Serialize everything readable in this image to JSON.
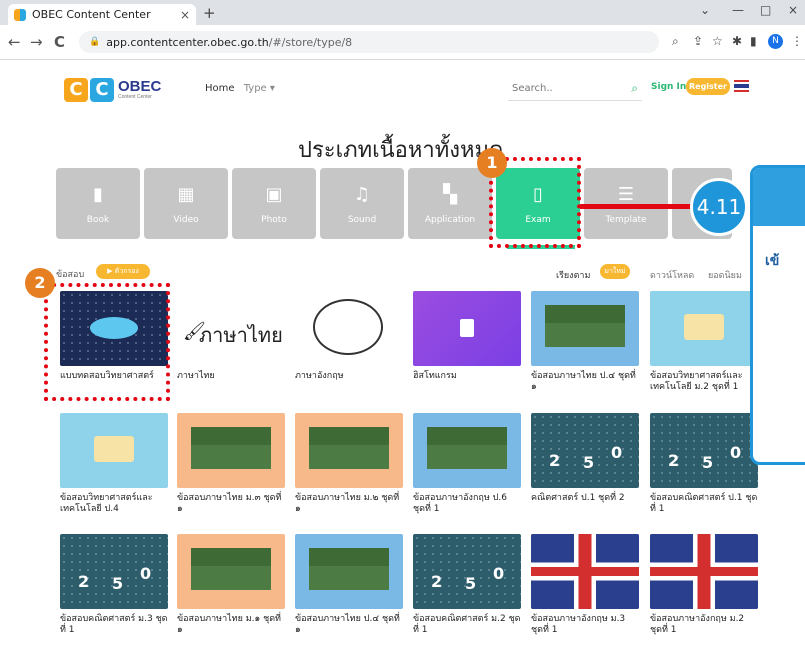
{
  "browser": {
    "tab_title": "OBEC Content Center",
    "tab_close": "×",
    "new_tab": "+",
    "url_host": "app.contentcenter.obec.go.th",
    "url_path": "/#/store/type/8",
    "back": "←",
    "forward": "→",
    "reload": "C",
    "profile_initial": "N",
    "minimize": "—",
    "maximize": "□",
    "close": "×",
    "collapse": "⌄"
  },
  "site": {
    "logo_text": "OBEC",
    "logo_sub": "Content Center",
    "nav_home": "Home",
    "nav_type": "Type ▾",
    "search_placeholder": "Search..",
    "sign_in": "Sign In",
    "register": "Register"
  },
  "heading": "ประเภทเนื้อหาทั้งหมด",
  "types": [
    {
      "label": "Book",
      "icon": "book-icon",
      "glyph": "▮"
    },
    {
      "label": "Video",
      "icon": "film-icon",
      "glyph": "▦"
    },
    {
      "label": "Photo",
      "icon": "image-icon",
      "glyph": "▣"
    },
    {
      "label": "Sound",
      "icon": "music-icon",
      "glyph": "♫"
    },
    {
      "label": "Application",
      "icon": "grid-icon",
      "glyph": "▚"
    },
    {
      "label": "Exam",
      "icon": "document-icon",
      "glyph": "▯",
      "active": true
    },
    {
      "label": "Template",
      "icon": "list-icon",
      "glyph": "☰"
    }
  ],
  "category": {
    "label": "ข้อสอบ",
    "pill": "▶ ตัวกรอง"
  },
  "sort": {
    "label": "เรียงตาม",
    "options": [
      "มาใหม่",
      "ดาวน์โหลด",
      "ยอดนิยม"
    ]
  },
  "cards": [
    {
      "title": "แบบทดสอบวิทยาศาสตร์",
      "theme": "science"
    },
    {
      "title": "ภาษาไทย",
      "theme": "thai-text"
    },
    {
      "title": "ภาษาอังกฤษ",
      "theme": "english"
    },
    {
      "title": "ฮิสโทแกรม",
      "theme": "purple"
    },
    {
      "title": "ข้อสอบภาษาไทย ป.๔ ชุดที่ ๑",
      "theme": "blue"
    },
    {
      "title": "ข้อสอบวิทยาศาสตร์และเทคโนโลยี ม.2 ชุดที่ 1",
      "theme": "light"
    },
    {
      "title": "ข้อสอบวิทยาศาสตร์และเทคโนโลยี ป.4",
      "theme": "light"
    },
    {
      "title": "ข้อสอบภาษาไทย ม.๓ ชุดที่ ๑",
      "theme": "orange"
    },
    {
      "title": "ข้อสอบภาษาไทย ม.๒ ชุดที่ ๑",
      "theme": "orange"
    },
    {
      "title": "ข้อสอบภาษาอังกฤษ ป.6 ชุดที่ 1",
      "theme": "blue"
    },
    {
      "title": "คณิตศาสตร์ ป.1 ชุดที่ 2",
      "theme": "math"
    },
    {
      "title": "ข้อสอบคณิตศาสตร์ ป.1 ชุดที่ 1",
      "theme": "math"
    },
    {
      "title": "ข้อสอบคณิตศาสตร์ ม.3 ชุดที่ 1",
      "theme": "math"
    },
    {
      "title": "ข้อสอบภาษาไทย ม.๑ ชุดที่ ๑",
      "theme": "orange"
    },
    {
      "title": "ข้อสอบภาษาไทย ป.๔ ชุดที่ ๑",
      "theme": "blue"
    },
    {
      "title": "ข้อสอบคณิตศาสตร์ ม.2 ชุดที่ 1",
      "theme": "math"
    },
    {
      "title": "ข้อสอบภาษาอังกฤษ ม.3 ชุดที่ 1",
      "theme": "uk"
    },
    {
      "title": "ข้อสอบภาษาอังกฤษ ม.2 ชุดที่ 1",
      "theme": "uk"
    }
  ],
  "annotations": {
    "badge1": "1",
    "badge2": "2",
    "step": "4.11",
    "panel_partial": "เข้"
  },
  "colors": {
    "accent_green": "#2bcf94",
    "accent_orange": "#f7b731",
    "annotation_red": "#e30613",
    "annotation_blue": "#1f96d9"
  }
}
